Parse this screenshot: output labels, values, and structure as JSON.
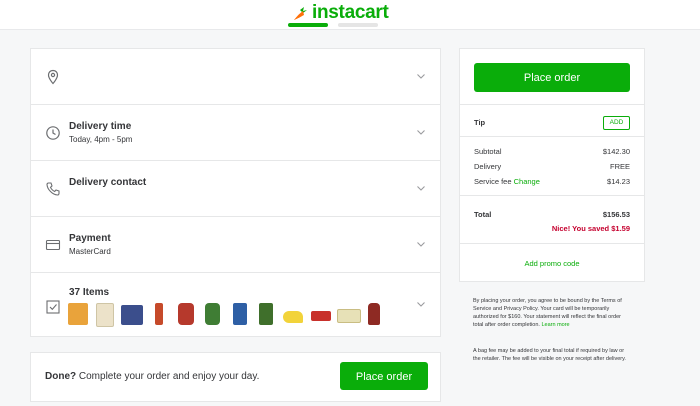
{
  "header": {
    "logo_text": "instacart",
    "accent": "#0aad0a"
  },
  "sections": {
    "address": {
      "icon": "location-pin-icon"
    },
    "delivery_time": {
      "title": "Delivery time",
      "value": "Today, 4pm - 5pm",
      "icon": "clock-icon"
    },
    "delivery_contact": {
      "title": "Delivery contact",
      "icon": "phone-icon"
    },
    "payment": {
      "title": "Payment",
      "value": "MasterCard",
      "icon": "credit-card-icon"
    },
    "items": {
      "title": "37 Items",
      "icon": "checklist-icon"
    }
  },
  "bottom_bar": {
    "done_bold": "Done?",
    "done_text": " Complete your order and enjoy your day.",
    "button": "Place order"
  },
  "summary": {
    "place_order": "Place order",
    "tip_label": "Tip",
    "tip_button": "ADD",
    "subtotal_label": "Subtotal",
    "subtotal_value": "$142.30",
    "delivery_label": "Delivery",
    "delivery_value": "FREE",
    "service_label": "Service fee",
    "service_link": "Change",
    "service_value": "$14.23",
    "total_label": "Total",
    "total_value": "$156.53",
    "savings": "Nice! You saved $1.59",
    "promo": "Add promo code"
  },
  "legal": {
    "terms": "By placing your order, you agree to be bound by the Terms of Service and Privacy Policy. Your card will be temporarily authorized for $160. Your statement will reflect the final order total after order completion.",
    "learn_more": "Learn more",
    "bag_fee": "A bag fee may be added to your final total if required by law or the retailer. The fee will be visible on your receipt after delivery."
  },
  "colors": {
    "savings_red": "#c5002e",
    "border": "#e6e7e8"
  }
}
